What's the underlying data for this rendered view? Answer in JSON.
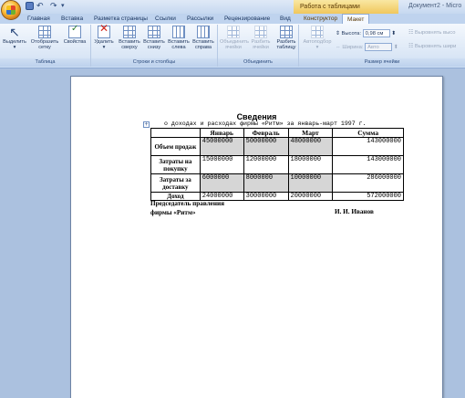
{
  "titlebar": {
    "context_title": "Работа с таблицами",
    "doc_title": "Документ2 - Micro"
  },
  "tabs": [
    {
      "label": "Главная"
    },
    {
      "label": "Вставка"
    },
    {
      "label": "Разметка страницы"
    },
    {
      "label": "Ссылки"
    },
    {
      "label": "Рассылки"
    },
    {
      "label": "Рецензирование"
    },
    {
      "label": "Вид"
    },
    {
      "label": "Конструктор"
    },
    {
      "label": "Макет"
    }
  ],
  "ribbon": {
    "group_table": {
      "label": "Таблица",
      "select": "Выделить",
      "gridlines_1": "Отобразить",
      "gridlines_2": "сетку",
      "properties": "Свойства"
    },
    "group_rows_cols": {
      "label": "Строки и столбцы",
      "delete": "Удалить",
      "insert_above_1": "Вставить",
      "insert_above_2": "сверху",
      "insert_below_1": "Вставить",
      "insert_below_2": "снизу",
      "insert_left_1": "Вставить",
      "insert_left_2": "слева",
      "insert_right_1": "Вставить",
      "insert_right_2": "справа"
    },
    "group_merge": {
      "label": "Объединить",
      "merge_cells_1": "Объединить",
      "merge_cells_2": "ячейки",
      "split_cells_1": "Разбить",
      "split_cells_2": "ячейки",
      "split_table_1": "Разбить",
      "split_table_2": "таблицу"
    },
    "group_cell_size": {
      "label": "Размер ячейки",
      "autofit": "Автоподбор",
      "height_label": "Высота:",
      "height_value": "0,98 см",
      "width_label": "Ширина:",
      "width_value": "Авто",
      "distribute_rows": "Выровнять высо",
      "distribute_cols": "Выровнять шири"
    }
  },
  "document": {
    "heading": "Сведения",
    "subheading": "о доходах и расходах фирмы «Ритм» за январь-март 1997 г.",
    "table": {
      "headers": [
        "",
        "Январь",
        "Февраль",
        "Март",
        "Сумма"
      ],
      "rows": [
        {
          "label": "Объем продаж",
          "jan": "45000000",
          "feb": "50000000",
          "mar": "48000000",
          "sum": "143000000"
        },
        {
          "label": "Затраты на покупку",
          "jan": "15000000",
          "feb": "12000000",
          "mar": "18000000",
          "sum": "143000000"
        },
        {
          "label": "Затраты за доставку",
          "jan": "6000000",
          "feb": "8000000",
          "mar": "10000000",
          "sum": "286000000"
        },
        {
          "label": "Доход",
          "jan": "24000000",
          "feb": "30000000",
          "mar": "20000000",
          "sum": "572000000"
        }
      ]
    },
    "signature_title_1": "Председатель правления",
    "signature_title_2": "фирмы «Ритм»",
    "signature_name": "И. И. Иванов"
  }
}
